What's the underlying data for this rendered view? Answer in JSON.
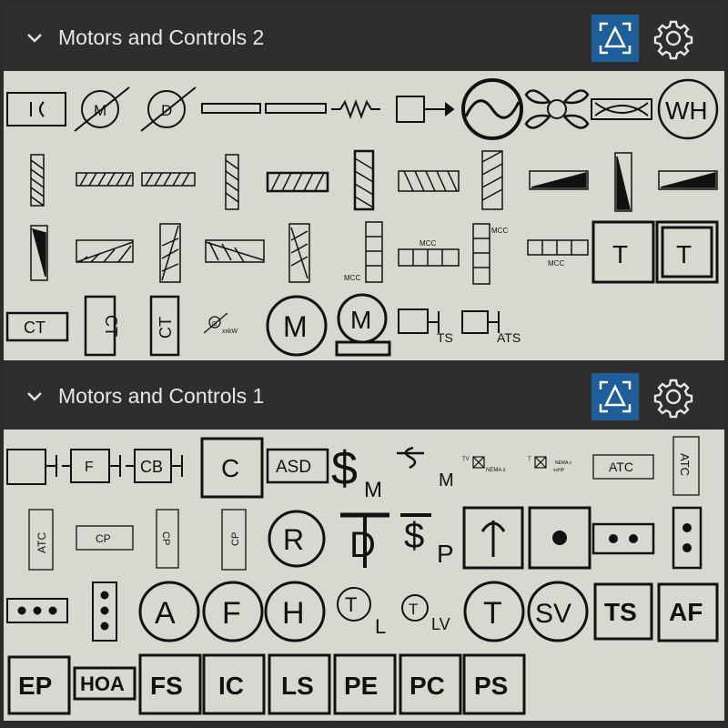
{
  "panels": [
    {
      "title": "Motors and Controls 2",
      "symbols": {
        "motor": "M",
        "damper": "D",
        "water_heater": "WH",
        "mcc": "MCC",
        "thermostat": "T",
        "current_transformer": "CT",
        "generator_g": "G",
        "generator_kw": "xxkW",
        "transfer_switch": "TS",
        "auto_transfer_switch": "ATS"
      }
    },
    {
      "title": "Motors and Controls 1",
      "symbols": {
        "fuse": "F",
        "circuit_breaker": "CB",
        "contactor": "C",
        "asd": "ASD",
        "switch_s": "$",
        "switch_m": "M",
        "switch_tv": "TV",
        "switch_nema": "NEMA x",
        "switch_tv_small": "T",
        "switch_nema_small": "NEMA x",
        "switch_xxhp": "xxHP",
        "atc": "ATC",
        "cp": "CP",
        "r": "R",
        "d": "D",
        "p": "P",
        "a": "A",
        "f": "F",
        "h": "H",
        "t": "T",
        "l": "L",
        "lv": "LV",
        "sv": "SV",
        "ts": "TS",
        "af": "AF",
        "ep": "EP",
        "hoa": "HOA",
        "fs": "FS",
        "ic": "IC",
        "ls": "LS",
        "pe": "PE",
        "pc": "PC",
        "ps": "PS"
      }
    }
  ]
}
